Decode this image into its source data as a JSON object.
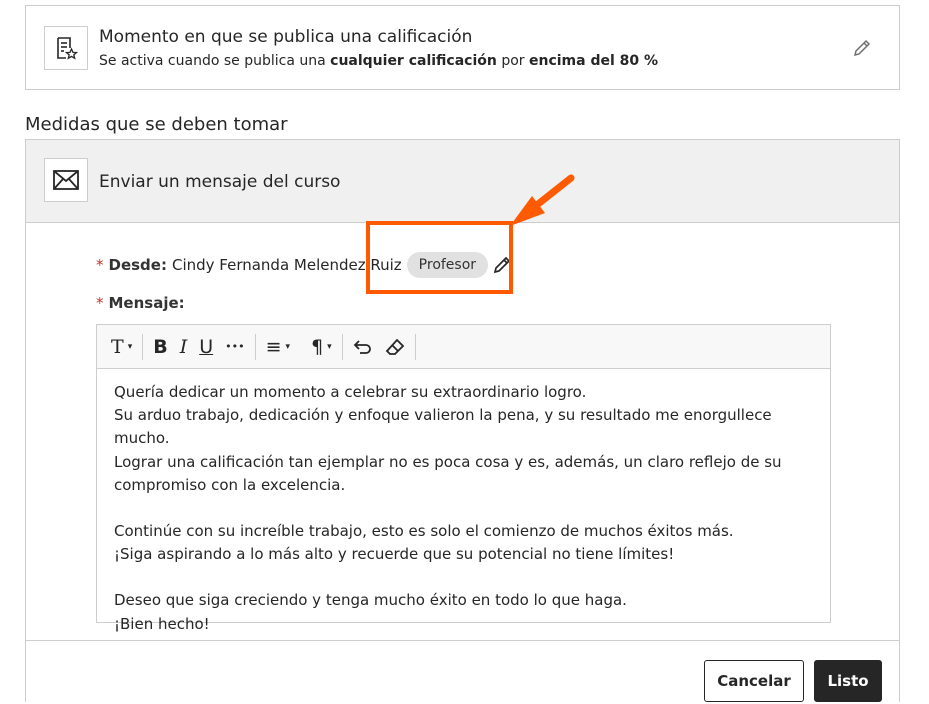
{
  "trigger": {
    "title": "Momento en que se publica una calificación",
    "desc_prefix": "Se activa cuando se publica una ",
    "desc_bold1": "cualquier calificación",
    "desc_middle": " por ",
    "desc_bold2": "encima del 80 %",
    "icon": "grade-document-icon",
    "edit_icon": "pencil-icon"
  },
  "section": {
    "title": "Medidas que se deben tomar"
  },
  "action": {
    "title": "Enviar un mensaje del curso",
    "icon": "envelope-icon",
    "required_mark": "*",
    "from_label": "Desde:",
    "from_name": "Cindy Fernanda Melendez Ruiz",
    "role": "Profesor",
    "message_label": "Mensaje:",
    "toolbar": {
      "text_style": "T",
      "bold": "B",
      "italic": "I",
      "underline": "U",
      "more": "•••",
      "align": "≡",
      "paragraph": "¶",
      "caret": "▾"
    },
    "message_lines": [
      "Quería dedicar un momento a celebrar su extraordinario logro.",
      "Su arduo trabajo, dedicación y enfoque valieron la pena, y su resultado me enorgullece mucho.",
      "Lograr una calificación tan ejemplar no es poca cosa y es, además, un claro reflejo de su",
      "compromiso con la excelencia.",
      "",
      "Continúe con su increíble trabajo, esto es solo el comienzo de muchos éxitos más.",
      "¡Siga aspirando a lo más alto y recuerde que su potencial no tiene límites!",
      "",
      "Deseo que siga creciendo y tenga mucho éxito en todo lo que haga.",
      "¡Bien hecho!"
    ]
  },
  "buttons": {
    "cancel": "Cancelar",
    "done": "Listo"
  },
  "colors": {
    "highlight": "#ff5a00",
    "primary": "#262626",
    "required": "#c5352a",
    "header_bg": "#f0f0f0"
  }
}
